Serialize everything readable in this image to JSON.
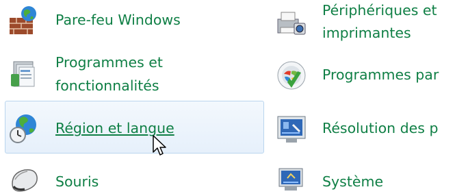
{
  "control_panel": {
    "left_column": [
      {
        "label_lines": [
          "Pare-feu Windows"
        ],
        "icon": "firewall-icon"
      },
      {
        "label_lines": [
          "Programmes et",
          "fonctionnalités"
        ],
        "icon": "programs-features-icon"
      },
      {
        "label_lines": [
          "Région et langue"
        ],
        "icon": "region-language-icon",
        "state": "hovered"
      },
      {
        "label_lines": [
          "Souris"
        ],
        "icon": "mouse-icon"
      }
    ],
    "right_column": [
      {
        "label_lines": [
          "Périphériques et",
          "imprimantes"
        ],
        "icon": "devices-printers-icon"
      },
      {
        "label_lines": [
          "Programmes par"
        ],
        "icon": "default-programs-icon"
      },
      {
        "label_lines": [
          "Résolution des p"
        ],
        "icon": "troubleshooting-icon"
      },
      {
        "label_lines": [
          "Système"
        ],
        "icon": "system-icon"
      }
    ]
  },
  "colors": {
    "link_text": "#0f7f45",
    "hover_border": "#b9d5ee",
    "hover_background": "#eaf2fb"
  }
}
